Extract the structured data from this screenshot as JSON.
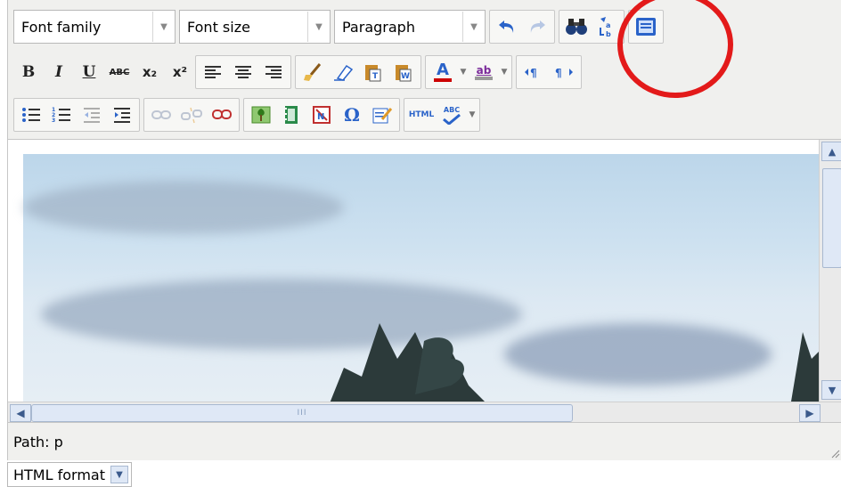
{
  "toolbar": {
    "font_family": {
      "value": "Font family"
    },
    "font_size": {
      "value": "Font size"
    },
    "block_format": {
      "value": "Paragraph"
    },
    "formatting": {
      "bold": "B",
      "italic": "I",
      "underline": "U",
      "strikethrough": "ABC",
      "subscript": "x₂",
      "superscript": "x²"
    },
    "font_color_label": "A",
    "highlight_color_label": "ab",
    "omega": "Ω",
    "html_label": "HTML",
    "spell_label": "ABC"
  },
  "status": {
    "path": "Path: p"
  },
  "scroll": {
    "grip": "III"
  },
  "format_selector": {
    "value": "HTML format"
  },
  "colors": {
    "highlight_circle": "#e31a1a",
    "toolbar_bg": "#f0f0ee",
    "font_color_bar": "#cc0000",
    "highlight_color_bar": "#999999"
  }
}
